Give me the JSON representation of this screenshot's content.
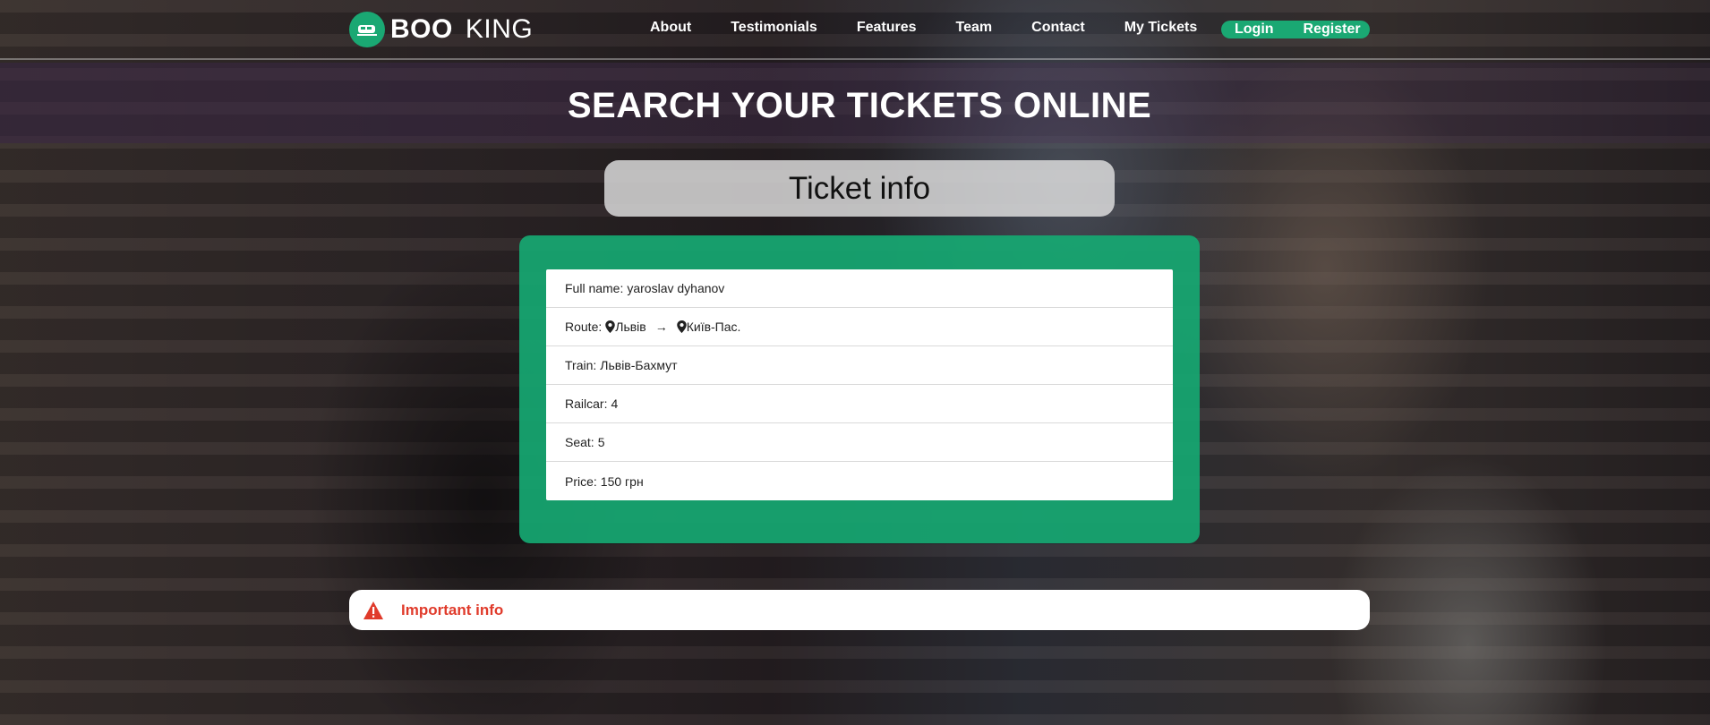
{
  "brand": {
    "part1": "BOO",
    "part2": "KING"
  },
  "nav": {
    "items": [
      "About",
      "Testimonials",
      "Features",
      "Team",
      "Contact",
      "My Tickets"
    ],
    "login": "Login",
    "register": "Register"
  },
  "page": {
    "heading": "SEARCH YOUR TICKETS ONLINE",
    "subtitle": "Ticket info"
  },
  "ticket": {
    "full_name_label": "Full name:",
    "full_name": "yaroslav dyhanov",
    "route_label": "Route:",
    "route_from": "Львів",
    "route_to": "Київ-Пас.",
    "train_label": "Train:",
    "train": "Львів-Бахмут",
    "railcar_label": "Railcar:",
    "railcar": "4",
    "seat_label": "Seat:",
    "seat": "5",
    "price_label": "Price:",
    "price": "150 грн"
  },
  "notice": {
    "text": "Important info"
  },
  "colors": {
    "accent": "#1aa873",
    "danger": "#e03b2b"
  },
  "icons": [
    "train-icon",
    "map-pin-icon",
    "arrow-right-icon",
    "warning-icon"
  ]
}
